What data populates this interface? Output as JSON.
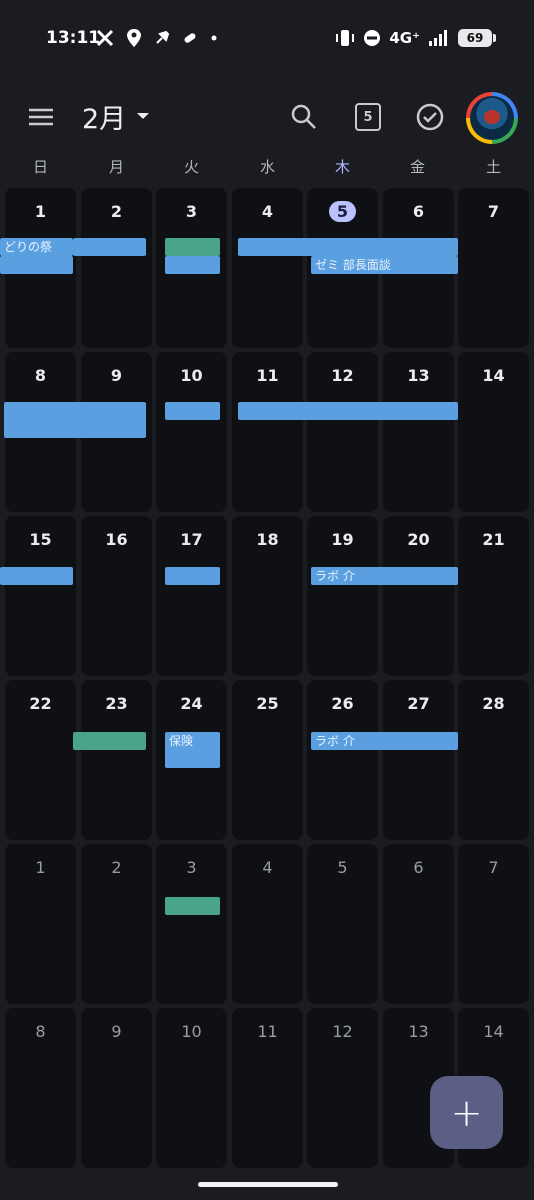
{
  "status_bar": {
    "time": "13:11",
    "network": "4G⁺",
    "battery": "69",
    "icons": [
      "x-logo-icon",
      "location-icon",
      "rocket-icon",
      "pill-icon",
      "dot-icon",
      "vibrate-icon",
      "dnd-icon",
      "signal-icon",
      "battery-icon"
    ]
  },
  "header": {
    "month_label": "2月",
    "today_badge": "5"
  },
  "weekdays": [
    "日",
    "月",
    "火",
    "水",
    "木",
    "金",
    "土"
  ],
  "weeks": [
    [
      "1",
      "2",
      "3",
      "4",
      "5",
      "6",
      "7"
    ],
    [
      "8",
      "9",
      "10",
      "11",
      "12",
      "13",
      "14"
    ],
    [
      "15",
      "16",
      "17",
      "18",
      "19",
      "20",
      "21"
    ],
    [
      "22",
      "23",
      "24",
      "25",
      "26",
      "27",
      "28"
    ],
    [
      "1",
      "2",
      "3",
      "4",
      "5",
      "6",
      "7"
    ],
    [
      "8",
      "9",
      "10",
      "11",
      "12",
      "13",
      "14"
    ]
  ],
  "muted_weeks": [
    4,
    5
  ],
  "today": {
    "week": 0,
    "day": 4
  },
  "events": [
    {
      "label": "どりの祭",
      "color": "blue"
    },
    {
      "label": "",
      "color": "blue"
    },
    {
      "label": "",
      "color": "green"
    },
    {
      "label": "",
      "color": "blue"
    },
    {
      "label": "ゼミ 部長面談",
      "color": "blue"
    },
    {
      "label": "",
      "color": "blue"
    },
    {
      "label": "",
      "color": "blue"
    },
    {
      "label": "",
      "color": "blue"
    },
    {
      "label": "",
      "color": "blue"
    },
    {
      "label": "",
      "color": "blue"
    },
    {
      "label": "ラボ 介",
      "color": "blue"
    },
    {
      "label": "",
      "color": "green"
    },
    {
      "label": "保険",
      "color": "blue"
    },
    {
      "label": "ラボ 介",
      "color": "blue"
    },
    {
      "label": "",
      "color": "green"
    }
  ],
  "colors": {
    "background": "#1b1c21",
    "cell": "#0f1014",
    "event_blue": "#5aa0e0",
    "event_green": "#4aa38b",
    "today_chip": "#b9c1ff",
    "fab": "#5b5f86"
  },
  "fab_label": "+"
}
